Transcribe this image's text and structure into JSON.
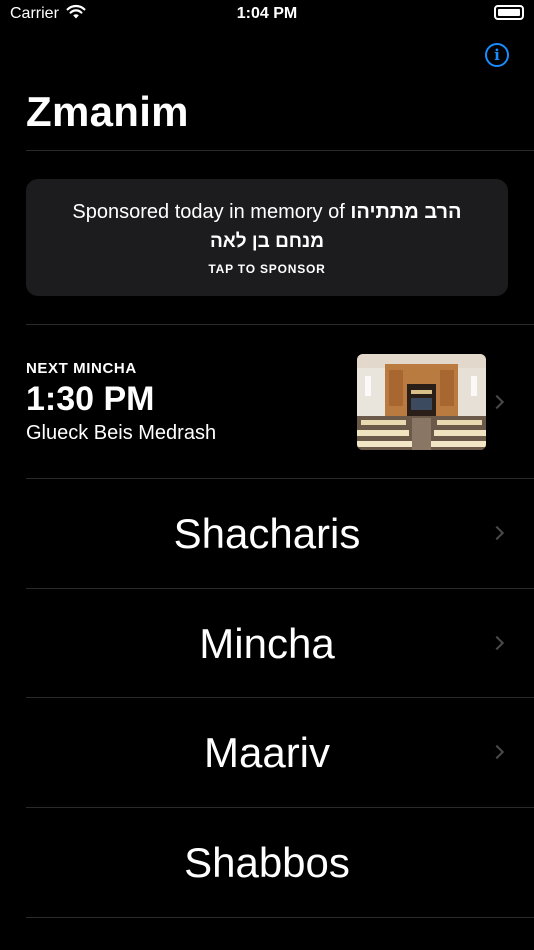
{
  "status_bar": {
    "carrier": "Carrier",
    "time": "1:04 PM",
    "icons": [
      "wifi-icon",
      "battery-icon"
    ]
  },
  "header": {
    "title": "Zmanim",
    "info_icon": "info-icon",
    "accent_color": "#1a8cff"
  },
  "sponsor": {
    "text_prefix": "Sponsored today in memory of",
    "hebrew_line1": "הרב מתתיהו",
    "hebrew_line2": "מנחם בן לאה",
    "cta": "TAP TO SPONSOR"
  },
  "next_mincha": {
    "label": "NEXT MINCHA",
    "time": "1:30 PM",
    "location": "Glueck Beis Medrash",
    "thumbnail": "beis-medrash-photo"
  },
  "prayers": [
    {
      "label": "Shacharis"
    },
    {
      "label": "Mincha"
    },
    {
      "label": "Maariv"
    },
    {
      "label": "Shabbos"
    }
  ]
}
